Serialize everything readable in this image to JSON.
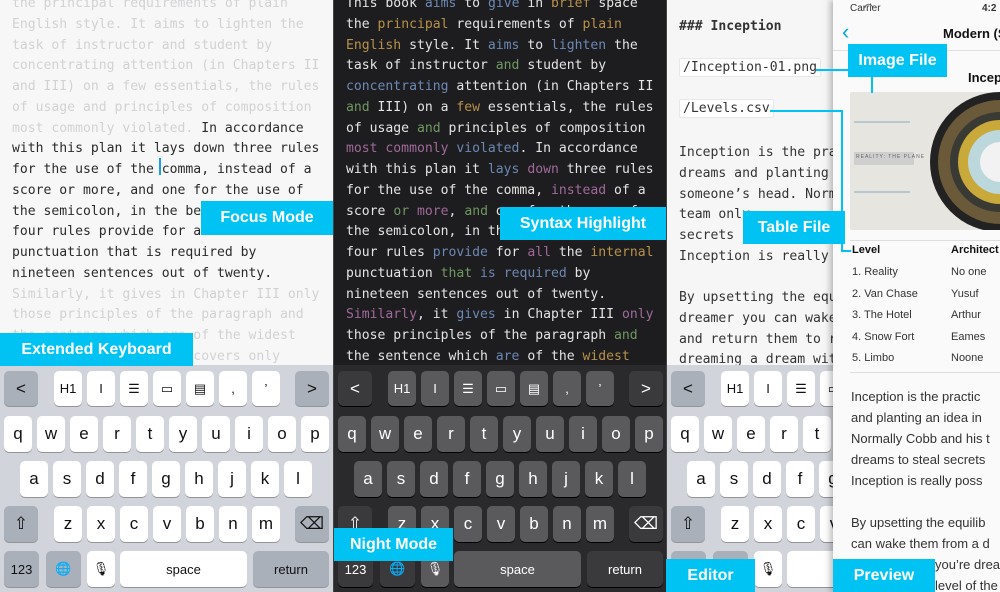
{
  "colors": {
    "accent": "#00c3f4",
    "verb": "#6c88b4",
    "adjective": "#b8914b",
    "conjunction": "#6f9862",
    "adverb": "#a0699a"
  },
  "callouts": {
    "focus": "Focus Mode",
    "extended_keyboard": "Extended Keyboard",
    "syntax": "Syntax Highlight",
    "night": "Night Mode",
    "image_file": "Image File",
    "table_file": "Table File",
    "editor": "Editor",
    "preview": "Preview"
  },
  "focus_panel": {
    "lines": [
      [
        [
          "the principal requirements of plain",
          0
        ]
      ],
      [
        [
          "English style. It aims to lighten the",
          0
        ]
      ],
      [
        [
          "task of instructor and student by",
          0
        ]
      ],
      [
        [
          "concentrating attention (in Chapters II",
          0
        ]
      ],
      [
        [
          "and III) on a few essentials, the rules",
          0
        ]
      ],
      [
        [
          "of usage and principles of composition",
          0
        ]
      ],
      [
        [
          "most commonly violated. ",
          0
        ],
        [
          "In accordance",
          1
        ]
      ],
      [
        [
          "with this plan it lays down three rules",
          1
        ]
      ],
      [
        [
          "for the use of the comma, instead of a",
          1
        ]
      ],
      [
        [
          "score or more, and one for the use of",
          1
        ]
      ],
      [
        [
          "the semicolon, in the belief that these",
          1
        ]
      ],
      [
        [
          "four rules provide for all the internal",
          1
        ]
      ],
      [
        [
          "punctuation that is required by",
          1
        ]
      ],
      [
        [
          "nineteen sentences out of twenty.",
          1
        ]
      ],
      [
        [
          "Similarly, it gives in Chapter III only",
          0
        ]
      ],
      [
        [
          "those principles of the paragraph and",
          0
        ]
      ],
      [
        [
          "the sentence which are of the widest",
          0
        ]
      ],
      [
        [
          "applicability. It thus covers only",
          0
        ]
      ]
    ]
  },
  "syntax_panel": {
    "lines": [
      [
        [
          "This book ",
          ""
        ],
        [
          "aims",
          "v"
        ],
        [
          " to ",
          ""
        ],
        [
          "give",
          "v"
        ],
        [
          " in ",
          ""
        ],
        [
          "brief",
          "a"
        ],
        [
          " space",
          ""
        ]
      ],
      [
        [
          "the ",
          ""
        ],
        [
          "principal",
          "a"
        ],
        [
          " requirements of ",
          ""
        ],
        [
          "plain",
          "a"
        ]
      ],
      [
        [
          "English",
          "a"
        ],
        [
          " style. It ",
          ""
        ],
        [
          "aims",
          "v"
        ],
        [
          " to ",
          ""
        ],
        [
          "lighten",
          "v"
        ],
        [
          " the",
          ""
        ]
      ],
      [
        [
          "task of instructor ",
          ""
        ],
        [
          "and",
          "c"
        ],
        [
          " student by",
          ""
        ]
      ],
      [
        [
          "concentrating",
          "v"
        ],
        [
          " attention (in Chapters II",
          ""
        ]
      ],
      [
        [
          "and",
          "c"
        ],
        [
          " III) on a ",
          ""
        ],
        [
          "few",
          "a"
        ],
        [
          " essentials, the rules",
          ""
        ]
      ],
      [
        [
          "of usage ",
          ""
        ],
        [
          "and",
          "c"
        ],
        [
          " principles of composition",
          ""
        ]
      ],
      [
        [
          "most commonly",
          "d"
        ],
        [
          " ",
          ""
        ],
        [
          "violated",
          "v"
        ],
        [
          ". In accordance",
          ""
        ]
      ],
      [
        [
          "with this plan it ",
          ""
        ],
        [
          "lays",
          "v"
        ],
        [
          " ",
          ""
        ],
        [
          "down",
          "d"
        ],
        [
          " three rules",
          ""
        ]
      ],
      [
        [
          "for the use of the comma, ",
          ""
        ],
        [
          "instead",
          "d"
        ],
        [
          " of a",
          ""
        ]
      ],
      [
        [
          "score ",
          ""
        ],
        [
          "or",
          "c"
        ],
        [
          " ",
          ""
        ],
        [
          "more",
          "d"
        ],
        [
          ", ",
          ""
        ],
        [
          "and",
          "c"
        ],
        [
          " one for the use of",
          ""
        ]
      ],
      [
        [
          "the semicolon, in the belief that these",
          ""
        ]
      ],
      [
        [
          "four rules ",
          ""
        ],
        [
          "provide",
          "v"
        ],
        [
          " for ",
          ""
        ],
        [
          "all",
          "d"
        ],
        [
          " the ",
          ""
        ],
        [
          "internal",
          "a"
        ]
      ],
      [
        [
          "punctuation ",
          ""
        ],
        [
          "that",
          "c"
        ],
        [
          " ",
          ""
        ],
        [
          "is required",
          "v"
        ],
        [
          " by",
          ""
        ]
      ],
      [
        [
          "nineteen sentences out of twenty.",
          ""
        ]
      ],
      [
        [
          "Similarly",
          "d"
        ],
        [
          ", it ",
          ""
        ],
        [
          "gives",
          "v"
        ],
        [
          " in Chapter III ",
          ""
        ],
        [
          "only",
          "d"
        ]
      ],
      [
        [
          "those principles of the paragraph ",
          ""
        ],
        [
          "and",
          "c"
        ]
      ],
      [
        [
          "the sentence which ",
          ""
        ],
        [
          "are",
          "v"
        ],
        [
          " of the ",
          ""
        ],
        [
          "widest",
          "a"
        ]
      ]
    ]
  },
  "keyboard": {
    "toolbar": [
      {
        "label": "<",
        "icon": "chevron-left-icon"
      },
      {
        "label": "H1",
        "icon": "heading-icon"
      },
      {
        "label": "I",
        "icon": "italic-icon"
      },
      {
        "label": "☰",
        "icon": "list-icon"
      },
      {
        "label": "▭",
        "icon": "image-insert-icon"
      },
      {
        "label": "▤",
        "icon": "table-insert-icon"
      },
      {
        "label": ",",
        "icon": "comma-icon"
      },
      {
        "label": "’",
        "icon": "apostrophe-icon"
      },
      {
        "label": ">",
        "icon": "chevron-right-icon"
      }
    ],
    "row1": [
      "q",
      "w",
      "e",
      "r",
      "t",
      "y",
      "u",
      "i",
      "o",
      "p"
    ],
    "row2": [
      "a",
      "s",
      "d",
      "f",
      "g",
      "h",
      "j",
      "k",
      "l"
    ],
    "row3": [
      "z",
      "x",
      "c",
      "v",
      "b",
      "n",
      "m"
    ],
    "shift": "⇧",
    "delete": "⌫",
    "numbers": "123",
    "globe": "🌐",
    "mic": "🎙",
    "space": "space",
    "return": "return"
  },
  "editor": {
    "heading": "### Inception",
    "image_ref": "/Inception-01.png",
    "table_ref": "/Levels.csv",
    "para1": [
      "Inception is the pra",
      "dreams and planting",
      "someone’s head. Norm",
      "team only",
      "secrets",
      "Inception is really"
    ],
    "para2": [
      "By upsetting the equ",
      "dreamer you can wake",
      "and return them to r",
      "dreaming a dream wit"
    ]
  },
  "preview": {
    "carrier": "Carrier",
    "time": "4:2",
    "title": "Modern (S",
    "doc_heading": "Incep",
    "image_caption": "REALITY: THE PLANE",
    "table": {
      "headers": [
        "Level",
        "Architect"
      ],
      "rows": [
        [
          "1. Reality",
          "No one"
        ],
        [
          "2. Van Chase",
          "Yusuf"
        ],
        [
          "3. The Hotel",
          "Arthur"
        ],
        [
          "4. Snow Fort",
          "Eames"
        ],
        [
          "5. Limbo",
          "Noone"
        ]
      ]
    },
    "para1": [
      "Inception is the practic",
      "and planting an idea in",
      "Normally Cobb and his t",
      "dreams to steal secrets",
      "Inception is really poss"
    ],
    "para2": [
      "By upsetting the equilib",
      "can wake them from a d",
      "you’re drea",
      "level of the"
    ]
  }
}
